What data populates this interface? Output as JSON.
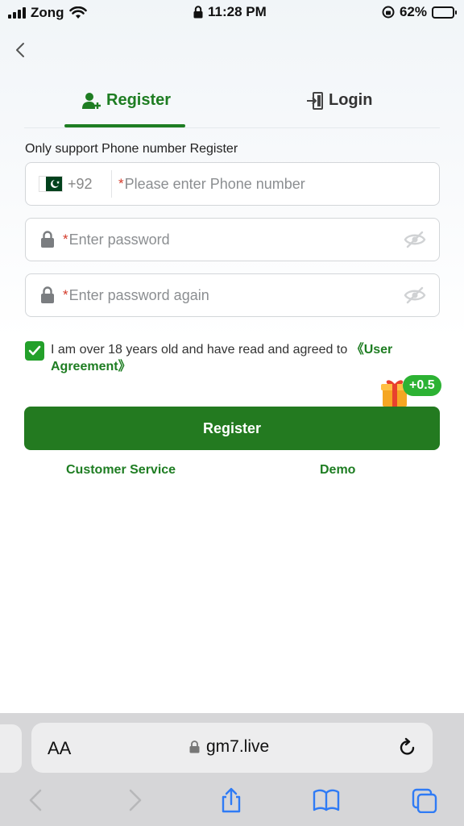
{
  "status_bar": {
    "carrier": "Zong",
    "time": "11:28 PM",
    "battery": "62%"
  },
  "tabs": {
    "register": "Register",
    "login": "Login"
  },
  "form": {
    "hint": "Only support Phone number Register",
    "country_code": "+92",
    "required_mark": "*",
    "phone_placeholder": "Please enter Phone number",
    "password_placeholder": "Enter password",
    "password_again_placeholder": "Enter password again",
    "agreement_text": "I am over 18 years old and have read and agreed to ",
    "agreement_link": "《User Agreement》",
    "bonus": "+0.5",
    "register_button": "Register"
  },
  "links": {
    "customer_service": "Customer Service",
    "demo": "Demo"
  },
  "browser": {
    "aa": "AA",
    "url": "gm7.live"
  },
  "colors": {
    "brand_green": "#1e7d22",
    "button_green": "#237a20",
    "required_red": "#d43a2a"
  }
}
